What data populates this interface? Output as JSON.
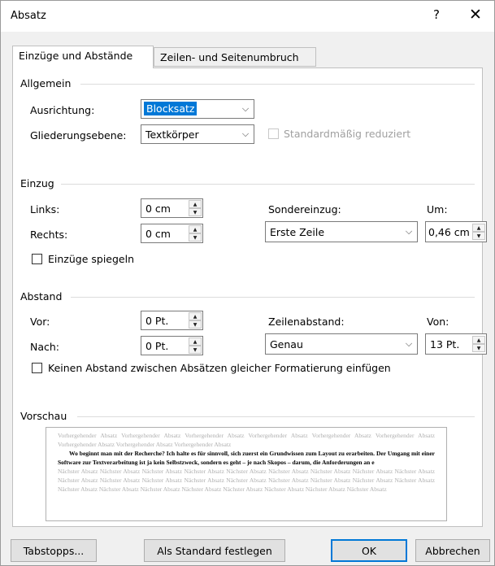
{
  "dialog": {
    "title": "Absatz",
    "help_label": "?",
    "close_label": "✕"
  },
  "tabs": [
    {
      "label": "Einzüge und Abstände",
      "active": true
    },
    {
      "label": "Zeilen- und Seitenumbruch",
      "active": false
    }
  ],
  "allgemein": {
    "title": "Allgemein",
    "ausrichtung_label": "Ausrichtung:",
    "ausrichtung_value": "Blocksatz",
    "gliederung_label": "Gliederungsebene:",
    "gliederung_value": "Textkörper",
    "standard_reduziert_label": "Standardmäßig reduziert"
  },
  "einzug": {
    "title": "Einzug",
    "links_label": "Links:",
    "links_value": "0 cm",
    "rechts_label": "Rechts:",
    "rechts_value": "0 cm",
    "sondereinzug_label": "Sondereinzug:",
    "sondereinzug_value": "Erste Zeile",
    "um_label": "Um:",
    "um_value": "0,46 cm",
    "spiegeln_label": "Einzüge spiegeln"
  },
  "abstand": {
    "title": "Abstand",
    "vor_label": "Vor:",
    "vor_value": "0 Pt.",
    "nach_label": "Nach:",
    "nach_value": "0 Pt.",
    "zeilenabstand_label": "Zeilenabstand:",
    "zeilenabstand_value": "Genau",
    "von_label": "Von:",
    "von_value": "13 Pt.",
    "keinen_abstand_label": "Keinen Abstand zwischen Absätzen gleicher Formatierung einfügen"
  },
  "vorschau": {
    "title": "Vorschau",
    "prev_text": "Vorhergehender Absatz Vorhergehender Absatz Vorhergehender Absatz Vorhergehender Absatz Vorhergehender Absatz Vorhergehender Absatz Vorhergehender Absatz Vorhergehender Absatz Vorhergehender Absatz",
    "main_text": "Wo beginnt man mit der Recherche? Ich halte es für sinnvoll, sich zuerst ein Grundwissen zum Layout zu erarbeiten. Der Umgang mit einer Software zur Textverarbeitung ist ja kein Selbstzweck, sondern es geht – je nach Skopos – darum, die Anforderungen an e",
    "next_text": "Nächster Absatz Nächster Absatz Nächster Absatz Nächster Absatz Nächster Absatz Nächster Absatz Nächster Absatz Nächster Absatz Nächster Absatz Nächster Absatz Nächster Absatz Nächster Absatz Nächster Absatz Nächster Absatz Nächster Absatz Nächster Absatz Nächster Absatz Nächster Absatz Nächster Absatz Nächster Absatz Nächster Absatz Nächster Absatz Nächster Absatz Nächster Absatz Nächster Absatz Nächster Absatz"
  },
  "buttons": {
    "tabstopps": "Tabstopps...",
    "standard": "Als Standard festlegen",
    "ok": "OK",
    "abbrechen": "Abbrechen"
  },
  "colors": {
    "selection": "#0078d7",
    "panel_bg": "#ffffff",
    "dialog_bg": "#f0f0f0"
  }
}
